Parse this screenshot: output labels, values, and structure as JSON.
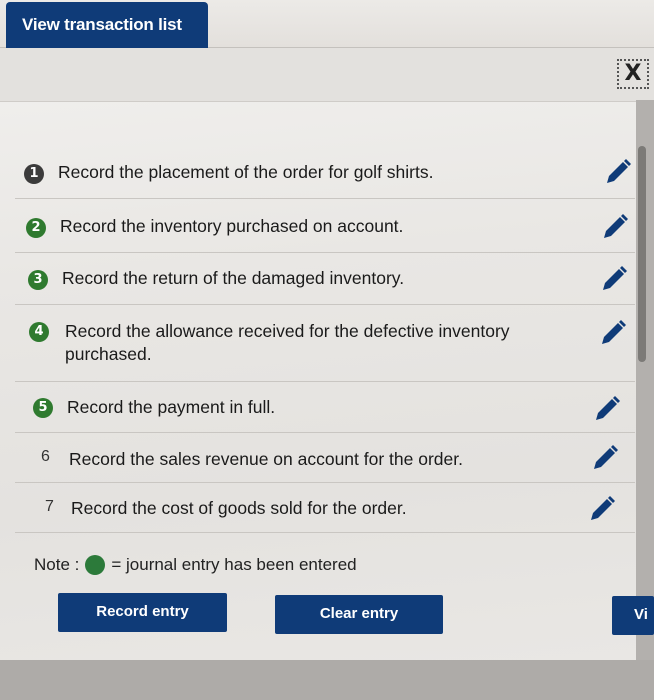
{
  "tab": {
    "label": "View transaction list"
  },
  "close": {
    "label": "X"
  },
  "transactions": [
    {
      "num": "1",
      "label": "Record the placement of the order for golf shirts.",
      "entered": false
    },
    {
      "num": "2",
      "label": "Record the inventory purchased on account.",
      "entered": true
    },
    {
      "num": "3",
      "label": "Record the return of the damaged inventory.",
      "entered": true
    },
    {
      "num": "4",
      "label": "Record the allowance received for the defective inventory purchased.",
      "entered": true
    },
    {
      "num": "5",
      "label": "Record the payment in full.",
      "entered": true
    },
    {
      "num": "6",
      "label": "Record the sales revenue on account for the order.",
      "entered": false
    },
    {
      "num": "7",
      "label": "Record the cost of goods sold for the order.",
      "entered": false
    }
  ],
  "note": {
    "prefix": "Note :",
    "suffix": "= journal entry has been entered",
    "dot_color": "#2c7a3a"
  },
  "buttons": {
    "record": "Record entry",
    "clear": "Clear entry",
    "view": "Vi"
  },
  "colors": {
    "primary": "#0f3b78",
    "entered": "#2f7a2f",
    "pending": "#3b3b3b"
  }
}
